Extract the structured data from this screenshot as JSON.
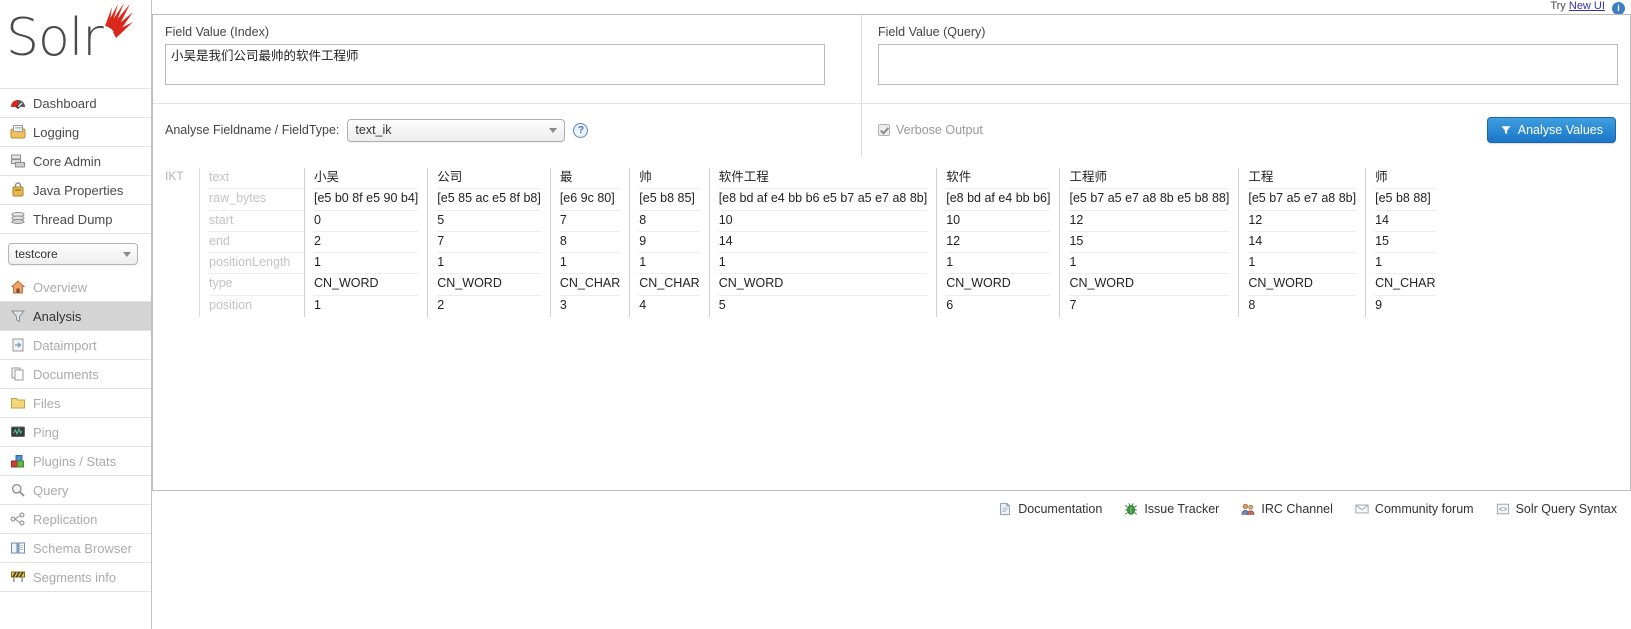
{
  "topbar": {
    "try_label": "Try",
    "new_ui_link": "New UI",
    "info_icon": "info-icon"
  },
  "branding": {
    "logo_text": "Solr",
    "logo_icon": "solr-sunburst-icon"
  },
  "sidebar": {
    "main_items": [
      {
        "label": "Dashboard",
        "icon": "dashboard-gauge-icon"
      },
      {
        "label": "Logging",
        "icon": "logging-tray-icon"
      },
      {
        "label": "Core Admin",
        "icon": "core-admin-servers-icon"
      },
      {
        "label": "Java Properties",
        "icon": "java-properties-icon"
      },
      {
        "label": "Thread Dump",
        "icon": "thread-dump-stack-icon"
      }
    ],
    "core_selector": {
      "value": "testcore",
      "caret_icon": "chevron-down-icon"
    },
    "core_items": [
      {
        "label": "Overview",
        "icon": "home-icon",
        "active": false
      },
      {
        "label": "Analysis",
        "icon": "funnel-icon",
        "active": true
      },
      {
        "label": "Dataimport",
        "icon": "dataimport-icon",
        "active": false
      },
      {
        "label": "Documents",
        "icon": "documents-icon",
        "active": false
      },
      {
        "label": "Files",
        "icon": "folder-icon",
        "active": false
      },
      {
        "label": "Ping",
        "icon": "ping-monitor-icon",
        "active": false
      },
      {
        "label": "Plugins / Stats",
        "icon": "plugins-blocks-icon",
        "active": false
      },
      {
        "label": "Query",
        "icon": "magnifier-icon",
        "active": false
      },
      {
        "label": "Replication",
        "icon": "replication-nodes-icon",
        "active": false
      },
      {
        "label": "Schema Browser",
        "icon": "book-icon",
        "active": false
      },
      {
        "label": "Segments info",
        "icon": "barrier-icon",
        "active": false
      }
    ]
  },
  "main": {
    "field_index": {
      "label": "Field Value (Index)",
      "value": "小吴是我们公司最帅的软件工程师",
      "placeholder": ""
    },
    "field_query": {
      "label": "Field Value (Query)",
      "value": "",
      "placeholder": ""
    },
    "fieldtype": {
      "label": "Analyse Fieldname / FieldType:",
      "value": "text_ik",
      "caret_icon": "chevron-down-icon",
      "help_icon": "help-question-icon",
      "help_label": "?"
    },
    "verbose": {
      "label": "Verbose Output",
      "checked": true
    },
    "analyse_button": {
      "label": "Analyse Values",
      "icon": "funnel-icon",
      "color": "#1b76c6"
    }
  },
  "analysis": {
    "analyzer_label": "IKT",
    "attributes": [
      "text",
      "raw_bytes",
      "start",
      "end",
      "positionLength",
      "type",
      "position"
    ],
    "tokens": [
      {
        "text": "小吴",
        "raw_bytes": "[e5 b0 8f e5 90 b4]",
        "start": "0",
        "end": "2",
        "positionLength": "1",
        "type": "CN_WORD",
        "position": "1"
      },
      {
        "text": "公司",
        "raw_bytes": "[e5 85 ac e5 8f b8]",
        "start": "5",
        "end": "7",
        "positionLength": "1",
        "type": "CN_WORD",
        "position": "2"
      },
      {
        "text": "最",
        "raw_bytes": "[e6 9c 80]",
        "start": "7",
        "end": "8",
        "positionLength": "1",
        "type": "CN_CHAR",
        "position": "3"
      },
      {
        "text": "帅",
        "raw_bytes": "[e5 b8 85]",
        "start": "8",
        "end": "9",
        "positionLength": "1",
        "type": "CN_CHAR",
        "position": "4"
      },
      {
        "text": "软件工程",
        "raw_bytes": "[e8 bd af e4 bb b6 e5 b7 a5 e7 a8 8b]",
        "start": "10",
        "end": "14",
        "positionLength": "1",
        "type": "CN_WORD",
        "position": "5"
      },
      {
        "text": "软件",
        "raw_bytes": "[e8 bd af e4 bb b6]",
        "start": "10",
        "end": "12",
        "positionLength": "1",
        "type": "CN_WORD",
        "position": "6"
      },
      {
        "text": "工程师",
        "raw_bytes": "[e5 b7 a5 e7 a8 8b e5 b8 88]",
        "start": "12",
        "end": "15",
        "positionLength": "1",
        "type": "CN_WORD",
        "position": "7"
      },
      {
        "text": "工程",
        "raw_bytes": "[e5 b7 a5 e7 a8 8b]",
        "start": "12",
        "end": "14",
        "positionLength": "1",
        "type": "CN_WORD",
        "position": "8"
      },
      {
        "text": "师",
        "raw_bytes": "[e5 b8 88]",
        "start": "14",
        "end": "15",
        "positionLength": "1",
        "type": "CN_CHAR",
        "position": "9"
      }
    ]
  },
  "footer": {
    "links": [
      {
        "label": "Documentation",
        "icon": "document-icon"
      },
      {
        "label": "Issue Tracker",
        "icon": "bug-icon"
      },
      {
        "label": "IRC Channel",
        "icon": "people-icon"
      },
      {
        "label": "Community forum",
        "icon": "envelope-icon"
      },
      {
        "label": "Solr Query Syntax",
        "icon": "code-icon"
      }
    ]
  }
}
